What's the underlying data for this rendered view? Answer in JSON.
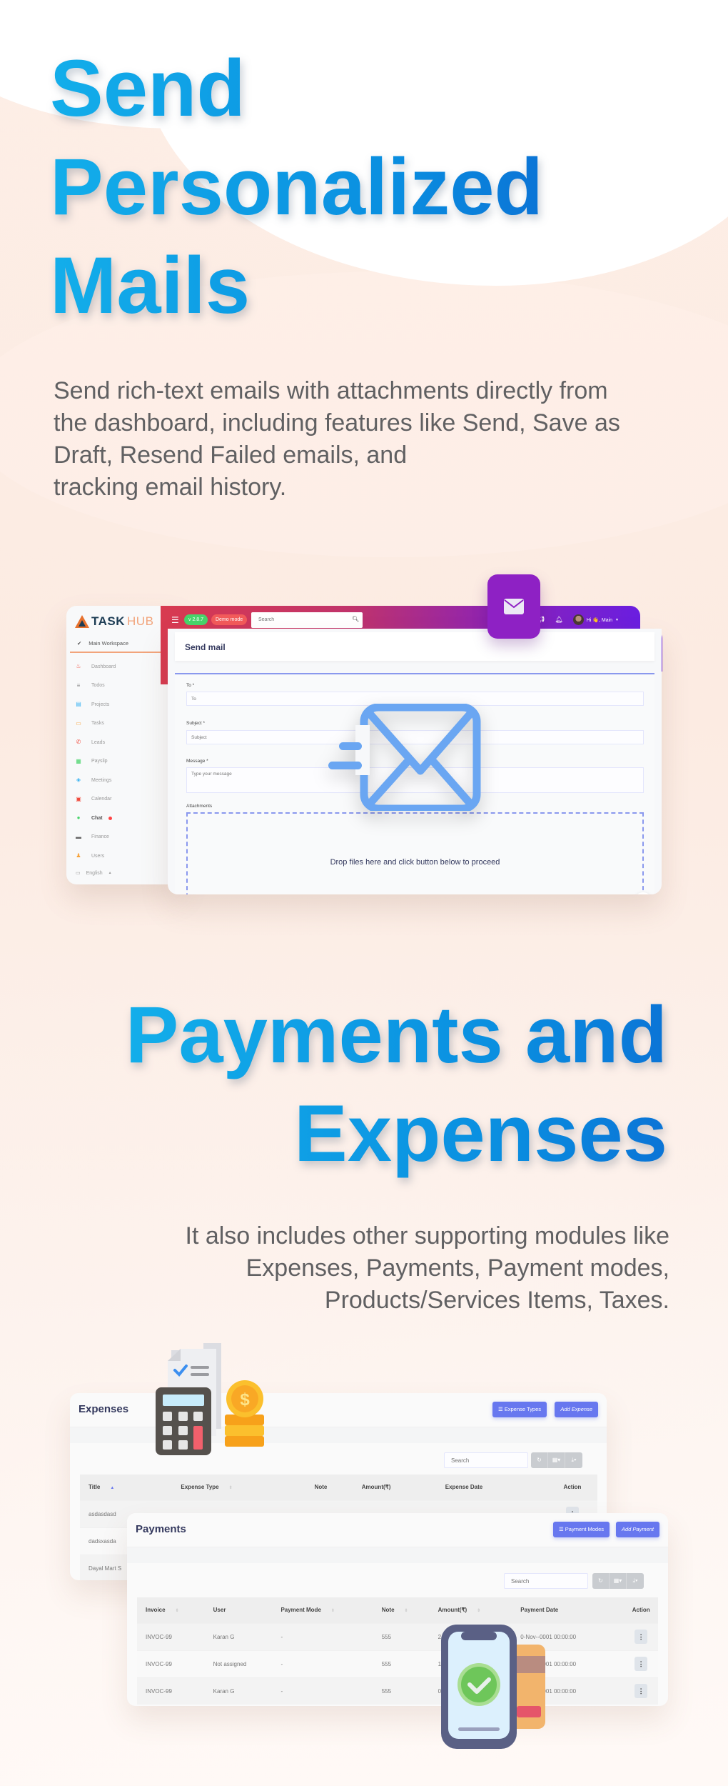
{
  "section1": {
    "title_lines": [
      "Send",
      "Personalized",
      "Mails"
    ],
    "description_lines": [
      "Send rich-text emails with attachments directly from",
      "the dashboard, including features like Send, Save as",
      "Draft, Resend Failed emails, and",
      "tracking email history."
    ]
  },
  "mail_app": {
    "logo": {
      "part1": "TASK",
      "part2": "HUB"
    },
    "workspace": "Main Workspace",
    "sidebar": [
      {
        "label": "Dashboard",
        "icon": "fire-icon",
        "color": "#f04a3c",
        "glyph": "♨"
      },
      {
        "label": "Todos",
        "icon": "list-icon",
        "color": "#888888",
        "glyph": "≡"
      },
      {
        "label": "Projects",
        "icon": "file-icon",
        "color": "#3bb4f2",
        "glyph": "▤",
        "has_submenu": true
      },
      {
        "label": "Tasks",
        "icon": "tasks-icon",
        "color": "#f7a33b",
        "glyph": "▭"
      },
      {
        "label": "Leads",
        "icon": "phone-icon",
        "color": "#f04a3c",
        "glyph": "✆"
      },
      {
        "label": "Payslip",
        "icon": "payslip-icon",
        "color": "#47d46a",
        "glyph": "▦"
      },
      {
        "label": "Meetings",
        "icon": "meetings-icon",
        "color": "#3bb4f2",
        "glyph": "◈"
      },
      {
        "label": "Calendar",
        "icon": "calendar-icon",
        "color": "#f04a3c",
        "glyph": "▣"
      },
      {
        "label": "Chat",
        "icon": "chat-icon",
        "color": "#47d46a",
        "glyph": "●",
        "active": true,
        "badge": true
      },
      {
        "label": "Finance",
        "icon": "finance-icon",
        "color": "#666666",
        "glyph": "▬",
        "has_submenu": true
      },
      {
        "label": "Users",
        "icon": "user-icon",
        "color": "#f7a33b",
        "glyph": "♟"
      }
    ],
    "language": "English",
    "header": {
      "version": "v 2.8.7",
      "demo_badge": "Demo mode",
      "search_placeholder": "Search",
      "greeting": "Hi 👋, Main"
    },
    "page_title": "Send mail",
    "form": {
      "to_label": "To *",
      "to_placeholder": "To",
      "subject_label": "Subject *",
      "subject_placeholder": "Subject",
      "message_label": "Message *",
      "message_placeholder": "Type your message",
      "attachments_label": "Attachments",
      "dropzone_text": "Drop files here and click button below to proceed"
    }
  },
  "section2": {
    "title_lines": [
      "Payments and",
      "Expenses"
    ],
    "description_lines": [
      "It also includes other supporting modules like",
      "Expenses, Payments, Payment modes,",
      "Products/Services Items, Taxes."
    ]
  },
  "expenses": {
    "title": "Expenses",
    "buttons": {
      "types": "☰ Expense Types",
      "add": "Add Expense"
    },
    "search_placeholder": "Search",
    "columns": [
      "Title",
      "Expense Type",
      "Note",
      "Amount(₹)",
      "Expense Date",
      "Action"
    ],
    "rows": [
      {
        "title": "asdasdasd"
      },
      {
        "title": "dadsxasda"
      },
      {
        "title": "Dayal Mart S"
      }
    ]
  },
  "payments": {
    "title": "Payments",
    "buttons": {
      "modes": "☰ Payment Modes",
      "add": "Add Payment"
    },
    "search_placeholder": "Search",
    "columns": [
      "Invoice",
      "User",
      "Payment Mode",
      "Note",
      "Amount(₹)",
      "Payment Date",
      "Action"
    ],
    "rows": [
      {
        "invoice": "INVOC-99",
        "user": "Karan G",
        "mode": "-",
        "note": "555",
        "amount": "2",
        "date": "0-Nov--0001 00:00:00"
      },
      {
        "invoice": "INVOC-99",
        "user": "Not assigned",
        "mode": "-",
        "note": "555",
        "amount": "1",
        "date": "0-Nov--0001 00:00:00"
      },
      {
        "invoice": "INVOC-99",
        "user": "Karan G",
        "mode": "-",
        "note": "555",
        "amount": "0",
        "date": "0-Nov--0001 00:00:00"
      }
    ]
  },
  "colors": {
    "title_blue": "#0a8ee0",
    "accent_indigo": "#6777ef",
    "header_start": "#d83a50",
    "header_end": "#6a1ee0",
    "mail_badge": "#8e21c4",
    "envelope_blue": "#6aa6f2"
  }
}
